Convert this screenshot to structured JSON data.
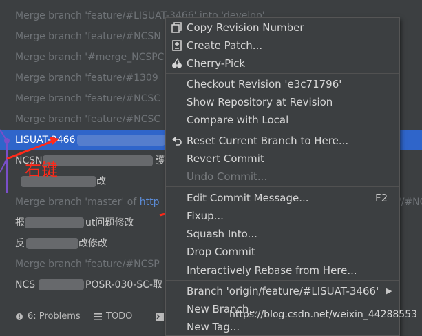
{
  "log_rows": [
    {
      "text": "Merge branch 'feature/#LISUAT-3466' into 'develop'",
      "style": "dim"
    },
    {
      "text": "Merge branch 'feature/#NCSN",
      "style": "dim"
    },
    {
      "text": "Merge branch '#merge_NCSPC",
      "style": "dim"
    },
    {
      "text": "Merge branch 'feature/#1309",
      "style": "dim"
    },
    {
      "text": "Merge branch 'feature/#NCSC",
      "style": "dim"
    },
    {
      "text": "Merge branch 'feature/#NCSC",
      "style": "dim"
    },
    {
      "text": "LISUAT-3466",
      "style": "selected"
    },
    {
      "text": "NCSN",
      "suffix": "護",
      "style": "light"
    },
    {
      "text": "",
      "suffix": "改",
      "style": "light"
    },
    {
      "text": "Merge branch 'master' of ",
      "link": "http",
      "tail": "//#NC",
      "style": "dim"
    },
    {
      "text": "报",
      "suffix": "ut问题修改",
      "style": "light"
    },
    {
      "text": "反",
      "suffix": "改修改",
      "style": "light"
    },
    {
      "text": "Merge branch 'feature/#NCSP",
      "style": "dim"
    },
    {
      "text": "NCS",
      "suffix": "POSR-030-SC-取",
      "style": "light"
    }
  ],
  "annotation": {
    "label": "右键",
    "color": "#ff2a1a"
  },
  "toolbar": {
    "items": [
      {
        "label": "6: Problems",
        "icon": "problems-icon"
      },
      {
        "label": "TODO",
        "icon": "todo-icon"
      },
      {
        "label": "",
        "icon": "terminal-icon"
      }
    ]
  },
  "context_menu": {
    "items": [
      {
        "label": "Copy Revision Number",
        "icon": "copy-icon",
        "enabled": true
      },
      {
        "label": "Create Patch...",
        "icon": "patch-icon",
        "enabled": true
      },
      {
        "label": "Cherry-Pick",
        "icon": "cherry-icon",
        "enabled": true
      },
      {
        "label": "Checkout Revision 'e3c71796'",
        "enabled": true
      },
      {
        "label": "Show Repository at Revision",
        "enabled": true
      },
      {
        "label": "Compare with Local",
        "enabled": true
      },
      {
        "label": "Reset Current Branch to Here...",
        "icon": "undo-icon",
        "enabled": true
      },
      {
        "label": "Revert Commit",
        "enabled": true
      },
      {
        "label": "Undo Commit...",
        "enabled": false
      },
      {
        "label": "Edit Commit Message...",
        "shortcut": "F2",
        "enabled": true
      },
      {
        "label": "Fixup...",
        "enabled": true
      },
      {
        "label": "Squash Into...",
        "enabled": true
      },
      {
        "label": "Drop Commit",
        "enabled": true
      },
      {
        "label": "Interactively Rebase from Here...",
        "enabled": true
      },
      {
        "label": "Branch 'origin/feature/#LISUAT-3466'",
        "submenu": true,
        "enabled": true
      },
      {
        "label": "New Branch...",
        "enabled": true
      },
      {
        "label": "New Tag...",
        "enabled": true
      }
    ]
  },
  "watermark": "https://blog.csdn.net/weixin_44288553"
}
